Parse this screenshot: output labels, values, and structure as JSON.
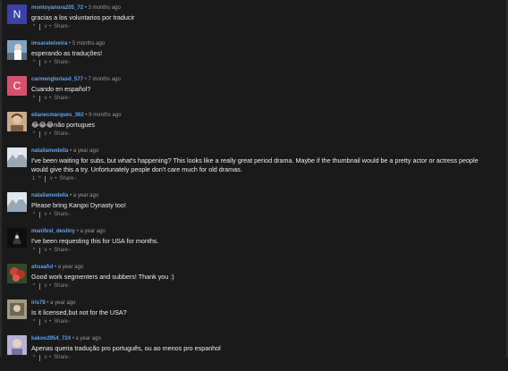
{
  "ui": {
    "upvote_symbol": "^",
    "downvote_symbol": "v",
    "dot": "•",
    "share_label": "Share",
    "share_chevron": "›"
  },
  "comments": [
    {
      "username": "montoyanora205_72",
      "timestamp": "3 months ago",
      "text": "gracias a los voluntarios por traducir",
      "score": "",
      "avatar_letter": "N",
      "avatar_color": "#3a41a8"
    },
    {
      "username": "imsarateixeira",
      "timestamp": "5 months ago",
      "text": "esperando as traduções!",
      "score": "",
      "avatar_letter": "",
      "avatar_color": "#6c8fb6"
    },
    {
      "username": "carmengloriasd_577",
      "timestamp": "7 months ago",
      "text": "Cuando en español?",
      "score": "",
      "avatar_letter": "C",
      "avatar_color": "#d8506e"
    },
    {
      "username": "elianecmarques_362",
      "timestamp": "9 months ago",
      "text": "😂😂😂não portugues",
      "score": "",
      "avatar_letter": "",
      "avatar_color": "#b99a7a"
    },
    {
      "username": "nataliamedella",
      "timestamp": "a year ago",
      "text": "I've been waiting for subs, but what's happening? This looks like a really great period drama. Maybe if the thumbnail would be a pretty actor or actress people would give this a try. Unfortunately people don't care much for old dramas.",
      "score": "1",
      "avatar_letter": "",
      "avatar_color": "#c9d3de"
    },
    {
      "username": "nataliamedella",
      "timestamp": "a year ago",
      "text": "Please bring Kangxi Dynasty too!",
      "score": "",
      "avatar_letter": "",
      "avatar_color": "#c9d3de"
    },
    {
      "username": "manifest_destiny",
      "timestamp": "a year ago",
      "text": "I've been requesting this for USA for months.",
      "score": "",
      "avatar_letter": "",
      "avatar_color": "#0e0e0e"
    },
    {
      "username": "ahsaaful",
      "timestamp": "a year ago",
      "text": "Good work segmenters and subbers! Thank you :)",
      "score": "",
      "avatar_letter": "",
      "avatar_color": "#c23a36"
    },
    {
      "username": "iris78",
      "timestamp": "a year ago",
      "text": "Is it licensed,but not for the USA?",
      "score": "",
      "avatar_letter": "",
      "avatar_color": "#8f8470"
    },
    {
      "username": "kakoo2954_724",
      "timestamp": "a year ago",
      "text": "Apenas queria tradução pro português, ou ao menos pro espanhol",
      "score": "",
      "avatar_letter": "",
      "avatar_color": "#a9a4c6"
    }
  ]
}
